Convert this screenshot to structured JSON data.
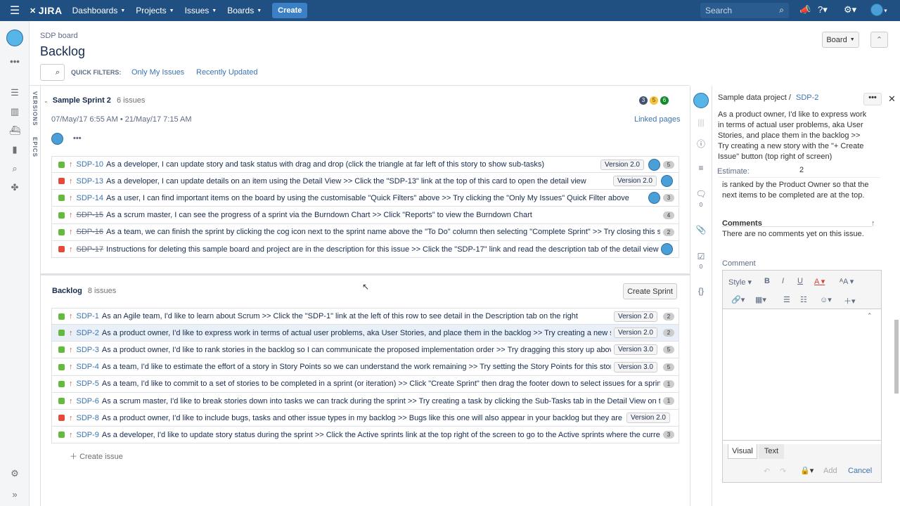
{
  "topnav": {
    "logo": "JIRA",
    "items": [
      "Dashboards",
      "Projects",
      "Issues",
      "Boards"
    ],
    "create": "Create",
    "search_placeholder": "Search"
  },
  "header": {
    "breadcrumb": "SDP board",
    "title": "Backlog",
    "board_button": "Board"
  },
  "filters": {
    "label": "QUICK FILTERS:",
    "only_mine": "Only My Issues",
    "recent": "Recently Updated"
  },
  "side_tabs": {
    "versions": "VERSIONS",
    "epics": "EPICS"
  },
  "sprint": {
    "name": "Sample Sprint 2",
    "count": "6 issues",
    "dates": "07/May/17 6:55 AM  •  21/May/17 7:15 AM",
    "linked": "Linked pages",
    "badges": [
      "3",
      "5",
      "6"
    ],
    "issues": [
      {
        "type": "story",
        "key": "SDP-10",
        "done": false,
        "summary": "As a developer, I can update story and task status with drag and drop (click the triangle at far left of this story to show sub-tasks)",
        "version": "Version 2.0",
        "avatar": true,
        "estimate": "5"
      },
      {
        "type": "bug",
        "key": "SDP-13",
        "done": false,
        "summary": "As a developer, I can update details on an item using the Detail View >> Click the \"SDP-13\" link at the top of this card to open the detail view",
        "version": "Version 2.0",
        "avatar": true,
        "estimate": ""
      },
      {
        "type": "story",
        "key": "SDP-14",
        "done": false,
        "summary": "As a user, I can find important items on the board by using the customisable \"Quick Filters\" above >> Try clicking the \"Only My Issues\" Quick Filter above",
        "version": "",
        "avatar": true,
        "estimate": "3"
      },
      {
        "type": "story",
        "key": "SDP-15",
        "done": true,
        "summary": "As a scrum master, I can see the progress of a sprint via the Burndown Chart >> Click \"Reports\" to view the Burndown Chart",
        "version": "",
        "avatar": false,
        "estimate": "4"
      },
      {
        "type": "story",
        "key": "SDP-16",
        "done": true,
        "summary": "As a team, we can finish the sprint by clicking the cog icon next to the sprint name above the \"To Do\" column then selecting \"Complete Sprint\" >> Try closing this sprint now",
        "version": "",
        "avatar": false,
        "estimate": "2"
      },
      {
        "type": "bug",
        "key": "SDP-17",
        "done": true,
        "summary": "Instructions for deleting this sample board and project are in the description for this issue >> Click the \"SDP-17\" link and read the description tab of the detail view for more",
        "version": "",
        "avatar": true,
        "estimate": ""
      }
    ]
  },
  "backlog": {
    "name": "Backlog",
    "count": "8 issues",
    "create_sprint": "Create Sprint",
    "create_issue": "Create issue",
    "issues": [
      {
        "type": "story",
        "key": "SDP-1",
        "summary": "As an Agile team, I'd like to learn about Scrum >> Click the \"SDP-1\" link at the left of this row to see detail in the Description tab on the right",
        "version": "Version 2.0",
        "estimate": "2"
      },
      {
        "type": "story",
        "key": "SDP-2",
        "summary": "As a product owner, I'd like to express work in terms of actual user problems, aka User Stories, and place them in the backlog >> Try creating a new story with",
        "version": "Version 2.0",
        "estimate": "2"
      },
      {
        "type": "story",
        "key": "SDP-3",
        "summary": "As a product owner, I'd like to rank stories in the backlog so I can communicate the proposed implementation order >> Try dragging this story up above the next",
        "version": "Version 3.0",
        "estimate": "5"
      },
      {
        "type": "story",
        "key": "SDP-4",
        "summary": "As a team, I'd like to estimate the effort of a story in Story Points so we can understand the work remaining >> Try setting the Story Points for this story in the",
        "version": "Version 3.0",
        "estimate": "5"
      },
      {
        "type": "story",
        "key": "SDP-5",
        "summary": "As a team, I'd like to commit to a set of stories to be completed in a sprint (or iteration) >> Click \"Create Sprint\" then drag the footer down to select issues for a sprint (you can",
        "version": "",
        "estimate": "1"
      },
      {
        "type": "story",
        "key": "SDP-6",
        "summary": "As a scrum master, I'd like to break stories down into tasks we can track during the sprint >> Try creating a task by clicking the Sub-Tasks tab in the Detail View on the right",
        "version": "",
        "estimate": "1"
      },
      {
        "type": "bug",
        "key": "SDP-8",
        "summary": "As a product owner, I'd like to include bugs, tasks and other issue types in my backlog >> Bugs like this one will also appear in your backlog but they are not",
        "version": "Version 2.0",
        "estimate": ""
      },
      {
        "type": "story",
        "key": "SDP-9",
        "summary": "As a developer, I'd like to update story status during the sprint >> Click the Active sprints link at the top right of the screen to go to the Active sprints where the current Sprint",
        "version": "",
        "estimate": "3"
      }
    ]
  },
  "detail": {
    "project": "Sample data project /",
    "key": "SDP-2",
    "summary": "As a product owner, I'd like to express work in terms of actual user problems, aka User Stories, and place them in the backlog >> Try creating a new story with the \"+ Create Issue\" button (top right of screen)",
    "estimate_label": "Estimate:",
    "estimate": "2",
    "desc_tail": "is ranked by the Product Owner so that the next items to be completed are at the top.",
    "comments_heading": "Comments",
    "no_comments": "There are no comments yet on this issue.",
    "comment_label": "Comment",
    "style_label": "Style",
    "tab_visual": "Visual",
    "tab_text": "Text",
    "add": "Add",
    "cancel": "Cancel",
    "counts": [
      "0",
      "0"
    ]
  },
  "colors": {
    "nav": "#205081",
    "story": "#63ba3c",
    "bug": "#e5493a",
    "link": "#3b73af",
    "badge_todo": "#42526e",
    "badge_progress": "#f6c342",
    "badge_done": "#14892c"
  }
}
